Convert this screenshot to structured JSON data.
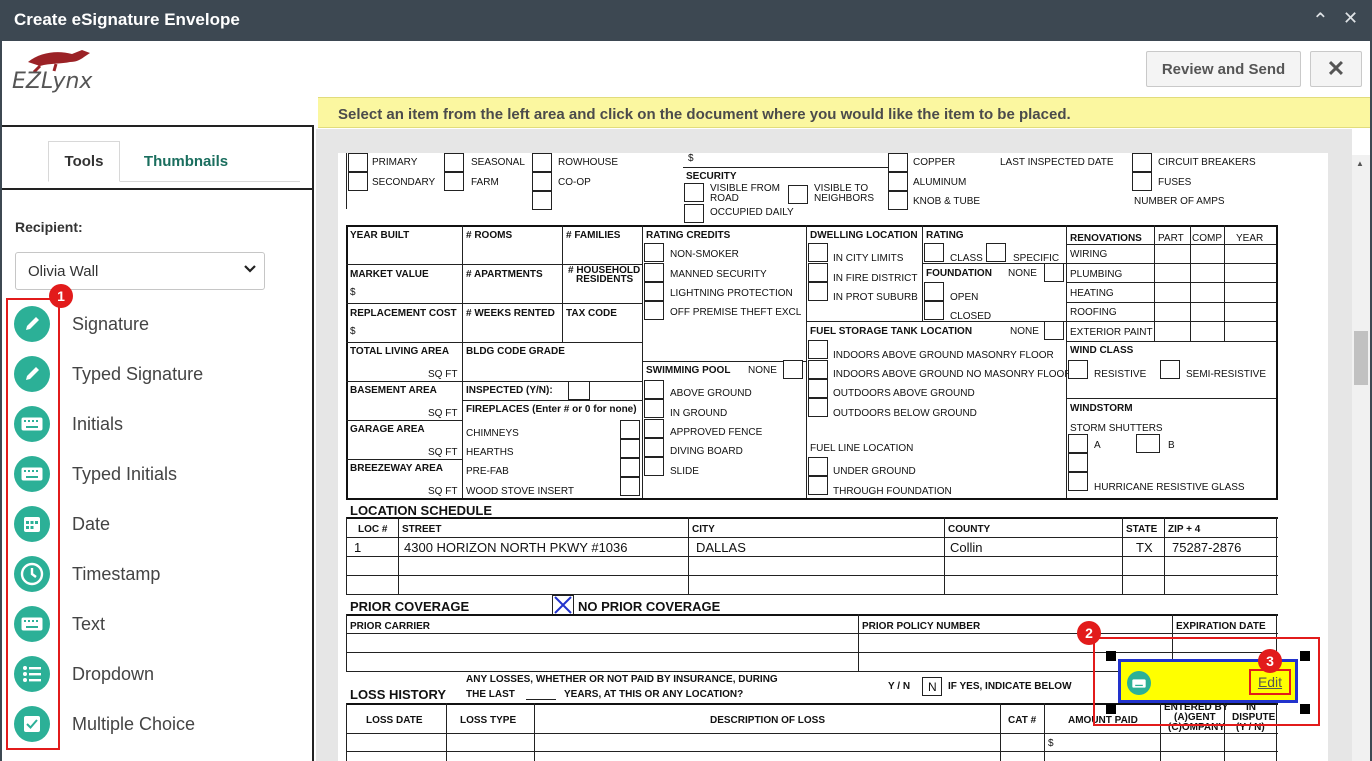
{
  "window": {
    "title": "Create eSignature Envelope",
    "collapse_icon": "chevron-up-icon",
    "close_icon": "close-icon"
  },
  "header": {
    "logo_text": "EZLynx",
    "review_send_label": "Review and Send",
    "close_label": "✕"
  },
  "banner": {
    "text": "Select an item from the left area and click on the document where you would like the item to be placed."
  },
  "left": {
    "tabs": [
      {
        "label": "Tools",
        "active": true
      },
      {
        "label": "Thumbnails",
        "active": false
      }
    ],
    "recipient_label": "Recipient:",
    "recipient_value": "Olivia Wall",
    "tools": [
      {
        "label": "Signature",
        "icon": "pen-icon"
      },
      {
        "label": "Typed Signature",
        "icon": "pen-icon"
      },
      {
        "label": "Initials",
        "icon": "keyboard-icon"
      },
      {
        "label": "Typed Initials",
        "icon": "keyboard-icon"
      },
      {
        "label": "Date",
        "icon": "calendar-icon"
      },
      {
        "label": "Timestamp",
        "icon": "clock-icon"
      },
      {
        "label": "Text",
        "icon": "keyboard-icon"
      },
      {
        "label": "Dropdown",
        "icon": "list-icon"
      },
      {
        "label": "Multiple Choice",
        "icon": "checkbox-icon"
      }
    ]
  },
  "callouts": [
    "1",
    "2",
    "3"
  ],
  "colors": {
    "accent": "#2cb097",
    "callout": "#e21b1b",
    "banner": "#fbf7a0",
    "field": "#ffff00",
    "titlebar": "#3d4852",
    "tab_text": "#1a6e5e"
  },
  "placed_field": {
    "edit_label": "Edit",
    "icon": "keyboard-icon"
  },
  "doc": {
    "top_row": {
      "c1": [
        "PRIMARY",
        "SECONDARY"
      ],
      "c2": [
        "SEASONAL",
        "FARM"
      ],
      "c3": [
        "ROWHOUSE",
        "CO-OP"
      ],
      "dollar": "$",
      "security": "SECURITY",
      "sec_opts": [
        "VISIBLE FROM",
        "ROAD",
        "VISIBLE TO",
        "NEIGHBORS",
        "OCCUPIED DAILY"
      ],
      "wiring": [
        "COPPER",
        "ALUMINUM",
        "KNOB & TUBE"
      ],
      "last_inspected": "LAST INSPECTED DATE",
      "elec": [
        "CIRCUIT BREAKERS",
        "FUSES",
        "NUMBER OF AMPS"
      ]
    },
    "grid": {
      "year_built": "YEAR BUILT",
      "rooms": "# ROOMS",
      "families": "# FAMILIES",
      "market_value": "MARKET VALUE",
      "apartments": "# APARTMENTS",
      "household": "# HOUSEHOLD",
      "residents": "RESIDENTS",
      "replacement": "REPLACEMENT COST",
      "weeks_rented": "# WEEKS RENTED",
      "tax_code": "TAX CODE",
      "living_area": "TOTAL LIVING AREA",
      "bldg_code": "BLDG CODE GRADE",
      "basement": "BASEMENT AREA",
      "inspected": "INSPECTED (Y/N):",
      "fireplaces": "FIREPLACES (Enter # or 0 for none)",
      "garage": "GARAGE AREA",
      "breezeway": "BREEZEWAY AREA",
      "sq_ft": "SQ FT",
      "dollar": "$",
      "fire_items": [
        "CHIMNEYS",
        "HEARTHS",
        "PRE-FAB",
        "WOOD STOVE INSERT"
      ],
      "rating_credits": "RATING CREDITS",
      "rc_items": [
        "NON-SMOKER",
        "MANNED SECURITY",
        "LIGHTNING PROTECTION",
        "OFF PREMISE THEFT EXCL"
      ],
      "swimming_pool": "SWIMMING POOL",
      "none": "NONE",
      "pool_items": [
        "ABOVE GROUND",
        "IN GROUND",
        "APPROVED FENCE",
        "DIVING BOARD",
        "SLIDE"
      ],
      "dwelling_location": "DWELLING LOCATION",
      "dl_items": [
        "IN CITY LIMITS",
        "IN FIRE DISTRICT",
        "IN PROT SUBURB"
      ],
      "rating": "RATING",
      "class": "CLASS",
      "specific": "SPECIFIC",
      "foundation": "FOUNDATION",
      "open": "OPEN",
      "closed": "CLOSED",
      "fuel_tank": "FUEL STORAGE TANK LOCATION",
      "ft_items": [
        "INDOORS ABOVE GROUND MASONRY FLOOR",
        "INDOORS ABOVE GROUND NO MASONRY FLOOR",
        "OUTDOORS ABOVE GROUND",
        "OUTDOORS BELOW GROUND"
      ],
      "fuel_line": "FUEL LINE LOCATION",
      "fl_items": [
        "UNDER GROUND",
        "THROUGH FOUNDATION"
      ],
      "renovations": "RENOVATIONS",
      "part": "PART",
      "comp": "COMP",
      "year": "YEAR",
      "ren_items": [
        "WIRING",
        "PLUMBING",
        "HEATING",
        "ROOFING",
        "EXTERIOR PAINT"
      ],
      "wind_class": "WIND CLASS",
      "resistive": "RESISTIVE",
      "semi_resistive": "SEMI-RESISTIVE",
      "windstorm": "WINDSTORM",
      "storm_shutters": "STORM SHUTTERS",
      "a": "A",
      "b": "B",
      "hurricane": "HURRICANE RESISTIVE GLASS"
    },
    "location": {
      "title": "LOCATION SCHEDULE",
      "headers": [
        "LOC #",
        "STREET",
        "CITY",
        "COUNTY",
        "STATE",
        "ZIP + 4"
      ],
      "row": [
        "1",
        "4300 HORIZON NORTH PKWY #1036",
        "DALLAS",
        "Collin",
        "TX",
        "75287-2876"
      ]
    },
    "prior": {
      "title": "PRIOR COVERAGE",
      "no_prior": "NO PRIOR COVERAGE",
      "carrier": "PRIOR CARRIER",
      "policy_number": "PRIOR POLICY NUMBER",
      "expiration": "EXPIRATION DATE"
    },
    "loss": {
      "title": "LOSS HISTORY",
      "q1": "ANY LOSSES, WHETHER OR NOT PAID BY INSURANCE, DURING",
      "q2": "THE LAST",
      "q3": "YEARS, AT THIS OR ANY LOCATION?",
      "yn": "Y / N",
      "n": "N",
      "if_yes": "IF YES, INDICATE BELOW",
      "headers": [
        "LOSS DATE",
        "LOSS TYPE",
        "DESCRIPTION OF LOSS",
        "CAT #",
        "AMOUNT PAID"
      ],
      "entered_by": [
        "ENTERED BY",
        "(A)GENT",
        "(C)OMPANY"
      ],
      "in_dispute": [
        "IN",
        "DISPUTE",
        "(Y / N)"
      ],
      "dollar": "$"
    }
  }
}
